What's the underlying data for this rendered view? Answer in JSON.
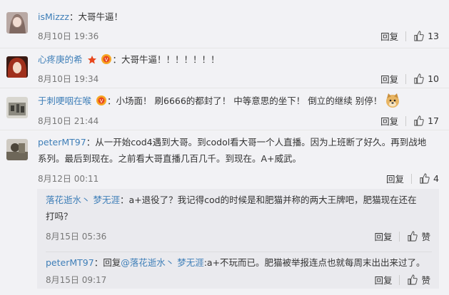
{
  "comments": [
    {
      "user": "isMizzz",
      "sep": "：",
      "text": "大哥牛逼！",
      "time": "8月10日 19:36",
      "reply_label": "回复",
      "likes": "13"
    },
    {
      "user": "心疼庚的希",
      "sep": "：",
      "text": "大哥牛逼！！！！！！！",
      "time": "8月10日 19:34",
      "reply_label": "回复",
      "likes": "10"
    },
    {
      "user": "于刺哽咽在喉",
      "sep": "：",
      "text": "小场面！ 刷6666的都封了！ 中等意思的坐下！ 倒立的继续 别停！",
      "time": "8月10日 21:44",
      "reply_label": "回复",
      "likes": "17"
    },
    {
      "user": "peterMT97",
      "sep": "：",
      "text_line1": "从一开始cod4遇到大哥。到codol看大哥一个人直播。因为上班断了好久。再到战地",
      "text_line2": "系列。最后到现在。之前看大哥直播几百几千。到现在。A+威武。",
      "time": "8月12日 00:11",
      "reply_label": "回复",
      "likes": "4"
    }
  ],
  "replies": [
    {
      "user": "落花逝水丶 梦无涯",
      "sep": "：",
      "text_line1": "a+退役了？我记得cod的时候是和肥猫并称的两大王牌吧，肥猫现在还在",
      "text_line2": "打吗？",
      "time": "8月15日 05:36",
      "reply_label": "回复",
      "like_label": "赞"
    },
    {
      "user": "peterMT97",
      "sep": "：",
      "prefix": "回复",
      "mention": "@落花逝水丶 梦无涯",
      "text": ":a+不玩而已。肥猫被举报连点也就每周末出出来过了。",
      "time": "8月15日 09:17",
      "reply_label": "回复",
      "like_label": "赞"
    }
  ],
  "colors": {
    "link": "#3f7fb8",
    "background": "#f2f2f5",
    "reply_background": "#eaeaee"
  }
}
